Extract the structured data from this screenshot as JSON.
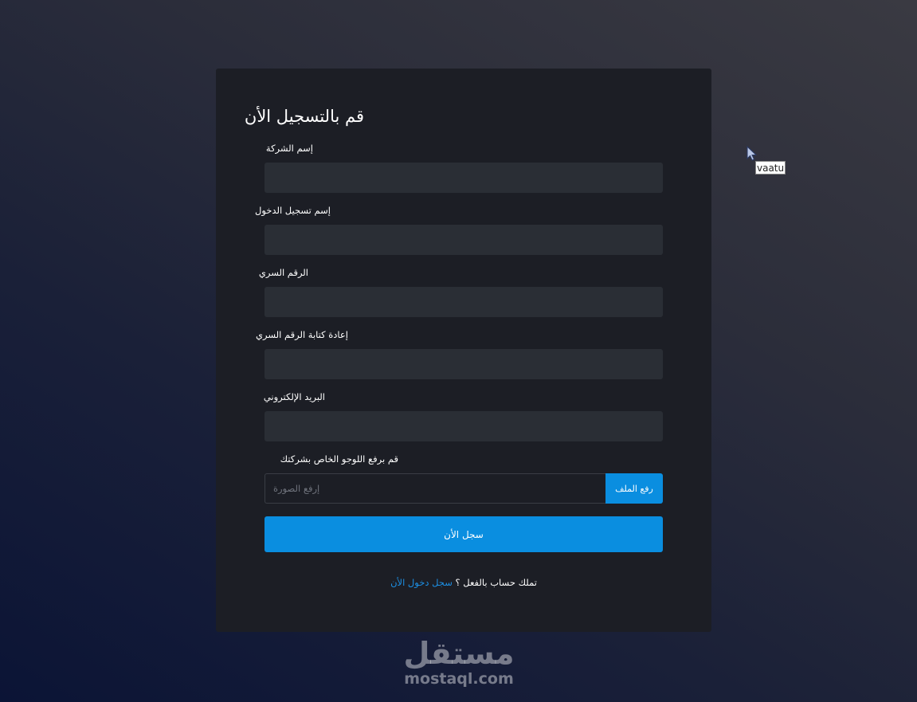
{
  "form": {
    "title": "قم بالتسجيل الأن",
    "fields": [
      {
        "label": "إسم الشركة",
        "value": "",
        "placeholder": ""
      },
      {
        "label": "إسم تسجيل الدخول",
        "value": "",
        "placeholder": ""
      },
      {
        "label": "الرقم السري",
        "value": "",
        "placeholder": ""
      },
      {
        "label": "إعادة كتابة الرقم السري",
        "value": "",
        "placeholder": ""
      },
      {
        "label": "البريد الإلكتروني",
        "value": "",
        "placeholder": ""
      }
    ],
    "logo_upload": {
      "label": "قم برفع اللوجو الخاص بشركتك",
      "placeholder": "إرفع الصورة",
      "button_label": "رفع الملف"
    },
    "submit_label": "سجل الأن",
    "login_prompt": {
      "text": "تملك حساب بالفعل ؟",
      "link_label": "سجل دخول الأن"
    }
  },
  "cursor_tooltip": "vaatu",
  "watermark": {
    "arabic": "مستقل",
    "latin": "mostaql.com"
  },
  "colors": {
    "accent": "#0a8ee0",
    "card": "#1c1e25",
    "input": "#2a2e35",
    "link": "#1c8fe3"
  }
}
